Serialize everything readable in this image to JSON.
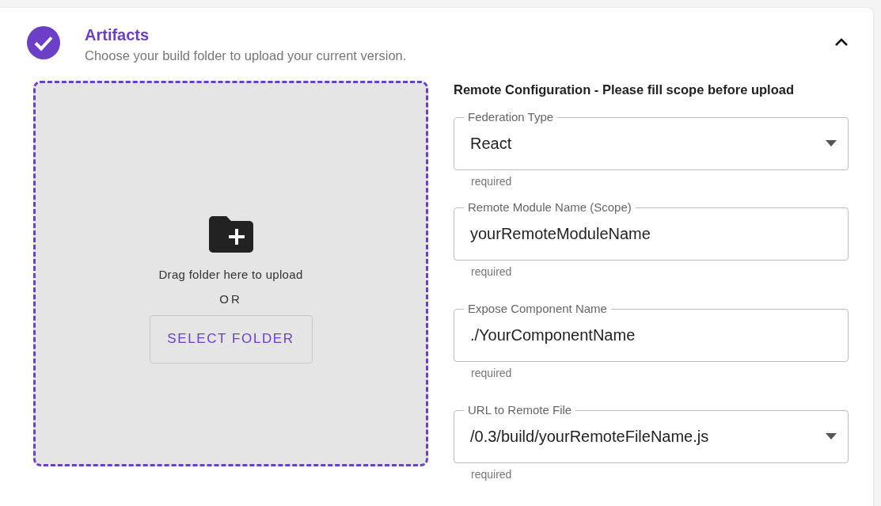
{
  "section": {
    "title": "Artifacts",
    "subtitle": "Choose your build folder to upload your current version.",
    "completed": true,
    "expanded": true
  },
  "dropzone": {
    "prompt": "Drag folder here to upload",
    "separator": "OR",
    "button": "SELECT FOLDER"
  },
  "form": {
    "heading": "Remote Configuration - Please fill scope before upload",
    "fields": [
      {
        "kind": "select",
        "label": "Federation Type",
        "value": "React",
        "helper": "required"
      },
      {
        "kind": "text",
        "label": "Remote Module Name (Scope)",
        "value": "yourRemoteModuleName",
        "helper": "required"
      },
      {
        "kind": "text",
        "label": "Expose Component Name",
        "value": "./YourComponentName",
        "helper": "required"
      },
      {
        "kind": "select",
        "label": "URL to Remote File",
        "value": "/0.3/build/yourRemoteFileName.js",
        "helper": "required"
      }
    ]
  }
}
